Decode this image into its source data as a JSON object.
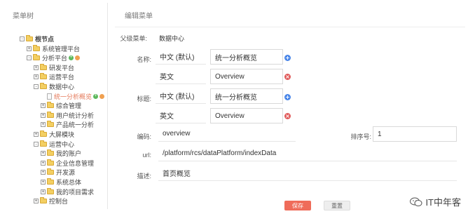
{
  "left_panel": {
    "title": "菜单树",
    "tree": [
      {
        "label": "根节点",
        "toggle": "-",
        "kind": "folder",
        "bold": true
      },
      {
        "label": "系统管理平台",
        "toggle": "+",
        "kind": "folder"
      },
      {
        "label": "分析平台",
        "toggle": "-",
        "kind": "folder",
        "actions": true
      },
      {
        "label": "研发平台",
        "toggle": "+",
        "kind": "folder"
      },
      {
        "label": "运营平台",
        "toggle": "+",
        "kind": "folder"
      },
      {
        "label": "数据中心",
        "toggle": "-",
        "kind": "folder"
      },
      {
        "label": "统一分析概览",
        "toggle": "",
        "kind": "doc",
        "selected": true,
        "actions": true
      },
      {
        "label": "综合管理",
        "toggle": "+",
        "kind": "folder"
      },
      {
        "label": "用户统计分析",
        "toggle": "+",
        "kind": "folder"
      },
      {
        "label": "产品统一分析",
        "toggle": "+",
        "kind": "folder"
      },
      {
        "label": "大屏模块",
        "toggle": "+",
        "kind": "folder"
      },
      {
        "label": "运营中心",
        "toggle": "-",
        "kind": "folder"
      },
      {
        "label": "我的账户",
        "toggle": "+",
        "kind": "folder"
      },
      {
        "label": "企业信息管理",
        "toggle": "+",
        "kind": "folder"
      },
      {
        "label": "开发源",
        "toggle": "+",
        "kind": "folder"
      },
      {
        "label": "系统总体",
        "toggle": "+",
        "kind": "folder"
      },
      {
        "label": "我的项目需求",
        "toggle": "+",
        "kind": "folder"
      },
      {
        "label": "控制台",
        "toggle": "+",
        "kind": "folder"
      }
    ]
  },
  "right_panel": {
    "title": "编辑菜单",
    "parent_label": "父级菜单:",
    "parent_value": "数据中心",
    "name_label": "名称:",
    "name_rows": [
      {
        "lang": "中文 (默认)",
        "value": "统一分析概览",
        "action": "add"
      },
      {
        "lang": "英文",
        "value": "Overview",
        "action": "delete"
      }
    ],
    "title_label": "标题:",
    "title_rows": [
      {
        "lang": "中文 (默认)",
        "value": "统一分析概览",
        "action": "add"
      },
      {
        "lang": "英文",
        "value": "Overview",
        "action": "delete"
      }
    ],
    "code_label": "编码:",
    "code_value": "overview",
    "sort_label": "排序号:",
    "sort_value": "1",
    "url_label": "url:",
    "url_value": "/platform/rcs/dataPlatform/indexData",
    "desc_label": "描述:",
    "desc_value": "首页概览",
    "save_label": "保存",
    "reset_label": "重置"
  },
  "watermark": {
    "text": "IT中年客"
  },
  "colors": {
    "add": "#4a86e8",
    "delete": "#e05a5a",
    "save": "#ef6c5a",
    "selected": "#e57a5a",
    "folder": "#f3cf62"
  }
}
